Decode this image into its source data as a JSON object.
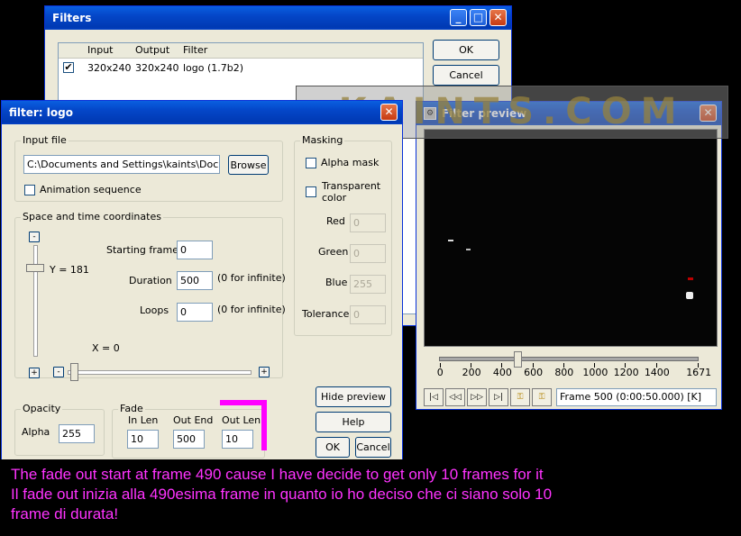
{
  "filters_window": {
    "title": "Filters",
    "columns": [
      "Input",
      "Output",
      "Filter"
    ],
    "row": {
      "checked": "✔",
      "input": "320x240",
      "output": "320x240",
      "filter": "logo (1.7b2)"
    },
    "ok_label": "OK",
    "cancel_label": "Cancel"
  },
  "logo_dialog": {
    "title": "filter: logo",
    "input_file": {
      "group_label": "Input file",
      "path": "C:\\Documents and Settings\\kaints\\Docume",
      "browse_label": "Browse",
      "animation_label": "Animation sequence"
    },
    "coords": {
      "group_label": "Space and time coordinates",
      "y_label": "Y = 181",
      "x_label": "X = 0",
      "starting_frame_label": "Starting frame",
      "starting_frame": "0",
      "duration_label": "Duration",
      "duration": "500",
      "duration_hint": "(0 for infinite)",
      "loops_label": "Loops",
      "loops": "0",
      "loops_hint": "(0 for infinite)",
      "plus": "+",
      "minus": "-"
    },
    "masking": {
      "group_label": "Masking",
      "alpha_mask": "Alpha mask",
      "transparent_color": "Transparent color",
      "red_label": "Red",
      "red": "0",
      "green_label": "Green",
      "green": "0",
      "blue_label": "Blue",
      "blue": "255",
      "tolerance_label": "Tolerance",
      "tolerance": "0"
    },
    "opacity": {
      "group_label": "Opacity",
      "alpha_label": "Alpha",
      "alpha": "255"
    },
    "fade": {
      "group_label": "Fade",
      "in_len_label": "In Len",
      "in_len": "10",
      "out_end_label": "Out End",
      "out_end": "500",
      "out_len_label": "Out Len",
      "out_len": "10"
    },
    "hide_preview_label": "Hide preview",
    "help_label": "Help",
    "ok_label": "OK",
    "cancel_label": "Cancel"
  },
  "preview_window": {
    "title": "Filter preview",
    "timeline_ticks": [
      "0",
      "200",
      "400",
      "600",
      "800",
      "1000",
      "1200",
      "1400",
      "1671"
    ],
    "current_frame": 500,
    "total_frames": 1671,
    "frame_label": "Frame 500 (0:00:50.000) [K]",
    "buttons": [
      "|<",
      "<<",
      ">>",
      ">|",
      "key-prev",
      "key-next"
    ]
  },
  "watermark": "KAINTS.COM",
  "caption": {
    "line1": "The fade out start at frame 490 cause I have decide to get only 10 frames for it",
    "line2": "Il fade out inizia alla 490esima frame in quanto io ho deciso che ci siano solo 10",
    "line3": "frame di durata!"
  },
  "colors": {
    "accent": "#0a5fe0",
    "caption": "#ff33ff",
    "highlight": "#ff00ff"
  }
}
